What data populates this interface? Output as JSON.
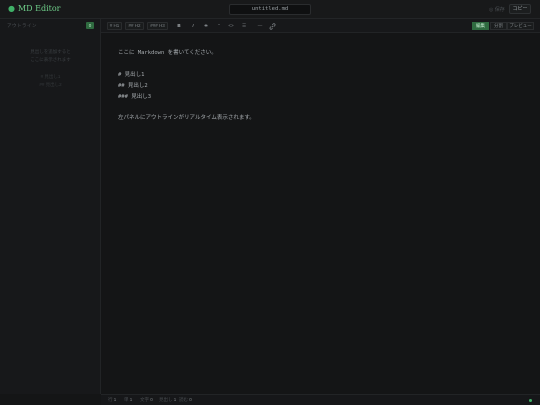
{
  "app": {
    "title": "MD Editor"
  },
  "header": {
    "filename": "untitled.md",
    "saved_label": "◎ 保存",
    "copy_label": "コピー"
  },
  "sidebar": {
    "heading": "アウトライン",
    "badge": "0",
    "empty_line1": "見出しを追加すると",
    "empty_line2": "ここに表示されます",
    "example1": "# 見出し1",
    "example2": "## 見出し2"
  },
  "toolbar": {
    "h1": "# H1",
    "h2": "## H2",
    "h3": "### H3",
    "bold": "B",
    "italic": "I",
    "strike": "S",
    "quote": "\"",
    "code": "<>",
    "list": "☰",
    "hr": "—",
    "modes": {
      "edit": "編集",
      "split": "分割",
      "preview": "プレビュー"
    }
  },
  "editor": {
    "lines": [
      "ここに Markdown を書いてください。",
      "# 見出し1",
      "## 見出し2",
      "### 見出し3",
      "左パネルにアウトラインがリアルタイム表示されます。"
    ]
  },
  "status": {
    "lines_label": "行",
    "lines": "1",
    "words_label": "単",
    "words": "1",
    "chars_label": "文字",
    "chars": "0",
    "headings_label": "見出し",
    "headings": "1",
    "read_label": "読む",
    "read": "0"
  },
  "colors": {
    "accent": "#3fb067",
    "accent_dark": "#2f6b40",
    "background": "#141516"
  }
}
